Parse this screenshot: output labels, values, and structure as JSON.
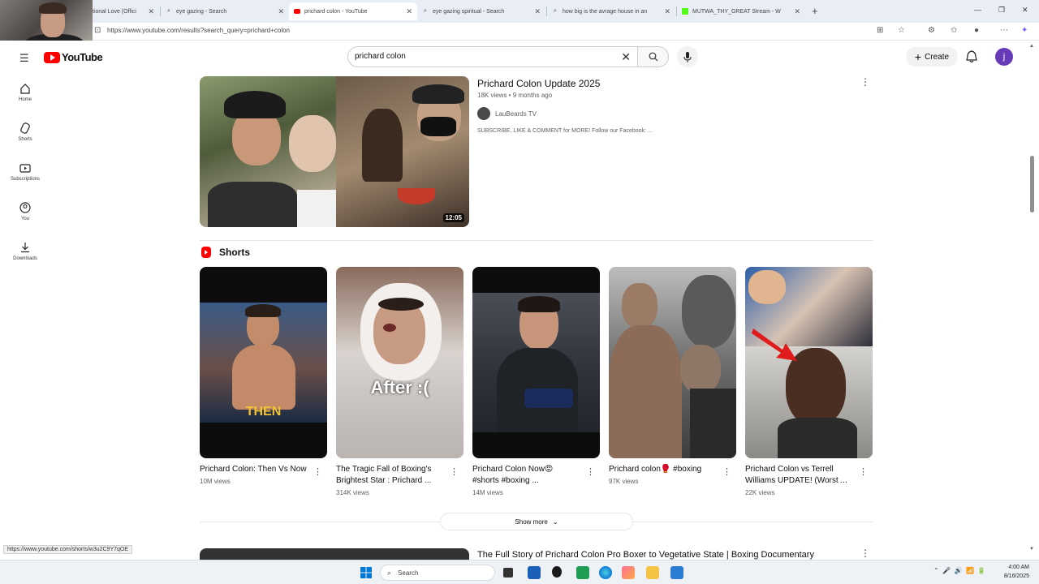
{
  "browser": {
    "tabs": [
      {
        "label": "tional Love (Offici",
        "active": false
      },
      {
        "label": "eye gazing - Search",
        "active": false
      },
      {
        "label": "prichard colon - YouTube",
        "active": true
      },
      {
        "label": "eye gazing spiritual - Search",
        "active": false
      },
      {
        "label": "how big is the avrage house in an",
        "active": false
      },
      {
        "label": "MUTWA_THY_GREAT Stream - W",
        "active": false
      }
    ],
    "url": "https://www.youtube.com/results?search_query=prichard+colon",
    "status_url": "https://www.youtube.com/shorts/w3u2C9Y7qOE"
  },
  "youtube": {
    "logo_text": "YouTube",
    "search_value": "prichard colon",
    "create_label": "Create",
    "avatar_letter": "j",
    "nav": [
      {
        "label": "Home",
        "icon": "home-icon"
      },
      {
        "label": "Shorts",
        "icon": "shorts-icon"
      },
      {
        "label": "Subscriptions",
        "icon": "subscriptions-icon"
      },
      {
        "label": "You",
        "icon": "you-icon"
      },
      {
        "label": "Downloads",
        "icon": "downloads-icon"
      }
    ]
  },
  "video": {
    "title": "Prichard Colon Update 2025",
    "meta": "18K views • 9 months ago",
    "channel": "LauBeards TV",
    "description": "SUBSCRIBE, LIKE & COMMENT for MORE! Follow our Facebook: ...",
    "duration": "12:05"
  },
  "shorts": {
    "title": "Shorts",
    "items": [
      {
        "title": "Prichard Colon: Then Vs Now",
        "views": "10M views",
        "overlay": "THEN"
      },
      {
        "title": "The Tragic Fall of Boxing's Brightest Star : Prichard ...",
        "views": "314K views",
        "overlay": "After :("
      },
      {
        "title": "Prichard Colon Now😡 #shorts #boxing ...",
        "views": "14M views",
        "overlay": ""
      },
      {
        "title": "Prichard colon🥊 #boxing",
        "views": "97K views",
        "overlay": ""
      },
      {
        "title": "Prichard Colon vs Terrell Williams UPDATE! (Worst ...",
        "views": "22K views",
        "overlay": ""
      }
    ],
    "show_more": "Show more"
  },
  "next_video": {
    "title": "The Full Story of Prichard Colon Pro Boxer to Vegetative State | Boxing Documentary"
  },
  "taskbar": {
    "search_label": "Search",
    "time": "4:00 AM",
    "date": "8/16/2025"
  },
  "colors": {
    "youtube_red": "#ff0000",
    "avatar_purple": "#673ab7"
  }
}
